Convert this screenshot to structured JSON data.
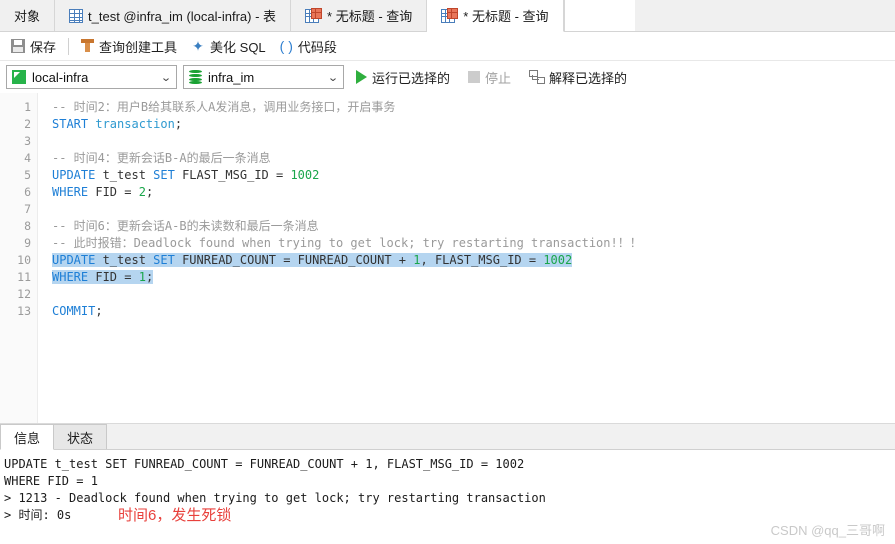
{
  "tabbar": {
    "object_tab": "对象",
    "tabs": [
      {
        "label": "t_test @infra_im (local-infra) - 表",
        "icon": "table-grid-icon",
        "active": false,
        "modified": false
      },
      {
        "label": "* 无标题 - 查询",
        "icon": "query-grid-icon",
        "active": false,
        "modified": true
      },
      {
        "label": "* 无标题 - 查询",
        "icon": "query-grid-icon",
        "active": true,
        "modified": true
      }
    ]
  },
  "toolbar": {
    "save_label": "保存",
    "builder_label": "查询创建工具",
    "beautify_label": "美化 SQL",
    "snippet_label": "代码段"
  },
  "connbar": {
    "connection": "local-infra",
    "database": "infra_im",
    "run_selected_label": "运行已选择的",
    "stop_label": "停止",
    "explain_selected_label": "解释已选择的",
    "stop_disabled": true
  },
  "editor": {
    "line_numbers": [
      1,
      2,
      3,
      4,
      5,
      6,
      7,
      8,
      9,
      10,
      11,
      12,
      13
    ],
    "lines": [
      {
        "n": 1,
        "segs": [
          {
            "t": "-- 时间2：用户B给其联系人A发消息，调用业务接口，开启事务",
            "c": "c"
          }
        ]
      },
      {
        "n": 2,
        "segs": [
          {
            "t": "START",
            "c": "k"
          },
          {
            "t": " ",
            "c": "p"
          },
          {
            "t": "transaction",
            "c": "kk"
          },
          {
            "t": ";",
            "c": "p"
          }
        ]
      },
      {
        "n": 3,
        "segs": [
          {
            "t": "",
            "c": "p"
          }
        ]
      },
      {
        "n": 4,
        "segs": [
          {
            "t": "-- 时间4：更新会话B-A的最后一条消息",
            "c": "c"
          }
        ]
      },
      {
        "n": 5,
        "segs": [
          {
            "t": "UPDATE",
            "c": "k"
          },
          {
            "t": " t_test ",
            "c": "p"
          },
          {
            "t": "SET",
            "c": "k"
          },
          {
            "t": " FLAST_MSG_ID = ",
            "c": "p"
          },
          {
            "t": "1002",
            "c": "n"
          }
        ]
      },
      {
        "n": 6,
        "segs": [
          {
            "t": "WHERE",
            "c": "k"
          },
          {
            "t": " FID = ",
            "c": "p"
          },
          {
            "t": "2",
            "c": "n"
          },
          {
            "t": ";",
            "c": "p"
          }
        ]
      },
      {
        "n": 7,
        "segs": [
          {
            "t": "",
            "c": "p"
          }
        ]
      },
      {
        "n": 8,
        "segs": [
          {
            "t": "-- 时间6：更新会话A-B的未读数和最后一条消息",
            "c": "c"
          }
        ]
      },
      {
        "n": 9,
        "segs": [
          {
            "t": "-- 此时报错：Deadlock found when trying to get lock; try restarting transaction!！！",
            "c": "c"
          }
        ]
      },
      {
        "n": 10,
        "selected": true,
        "segs": [
          {
            "t": "UPDATE",
            "c": "k"
          },
          {
            "t": " t_test ",
            "c": "p"
          },
          {
            "t": "SET",
            "c": "k"
          },
          {
            "t": " FUNREAD_COUNT = FUNREAD_COUNT + ",
            "c": "p"
          },
          {
            "t": "1",
            "c": "n"
          },
          {
            "t": ", FLAST_MSG_ID = ",
            "c": "p"
          },
          {
            "t": "1002",
            "c": "n"
          }
        ]
      },
      {
        "n": 11,
        "selected": true,
        "segs": [
          {
            "t": "WHERE",
            "c": "k"
          },
          {
            "t": " FID = ",
            "c": "p"
          },
          {
            "t": "1",
            "c": "n"
          },
          {
            "t": ";",
            "c": "p"
          }
        ]
      },
      {
        "n": 12,
        "segs": [
          {
            "t": "",
            "c": "p"
          }
        ]
      },
      {
        "n": 13,
        "segs": [
          {
            "t": "COMMIT",
            "c": "k"
          },
          {
            "t": ";",
            "c": "p"
          }
        ]
      }
    ]
  },
  "bottom": {
    "tabs": [
      {
        "label": "信息",
        "active": true
      },
      {
        "label": "状态",
        "active": false
      }
    ],
    "output_lines": [
      "UPDATE t_test SET FUNREAD_COUNT = FUNREAD_COUNT + 1, FLAST_MSG_ID = 1002",
      "WHERE FID = 1",
      "> 1213 - Deadlock found when trying to get lock; try restarting transaction",
      "> 时间: 0s"
    ],
    "annotation": "时间6，发生死锁",
    "annotation_color": "#e8413c",
    "watermark": "CSDN @qq_三哥啊"
  }
}
